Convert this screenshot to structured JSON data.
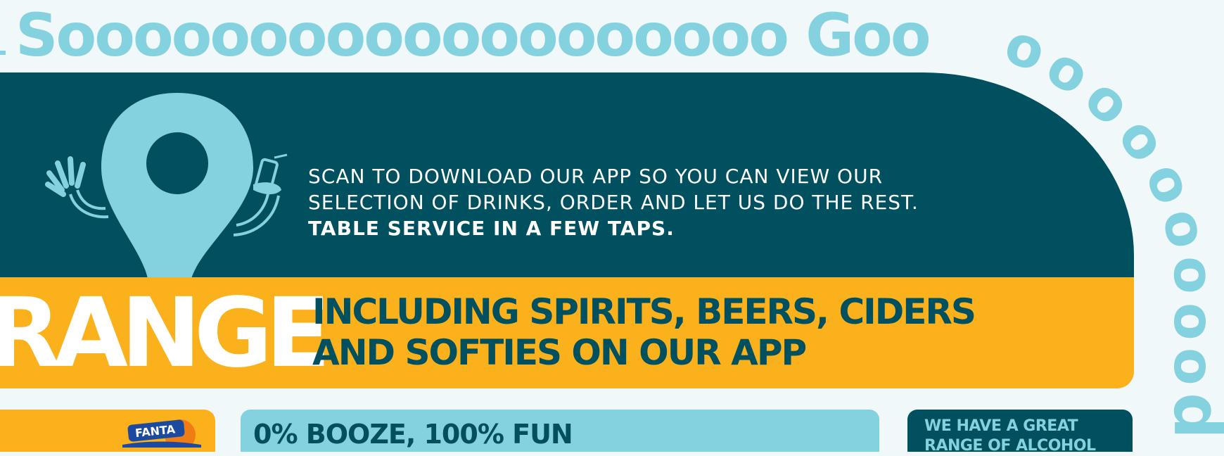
{
  "headline": {
    "text": "Sooooooooooooooooooo Goo",
    "arc_letters": [
      "o",
      "o",
      "o",
      "o",
      "o",
      "o",
      "o",
      "o",
      "o",
      "o",
      "d"
    ]
  },
  "app_promo": {
    "line1": "SCAN TO DOWNLOAD OUR APP SO YOU CAN VIEW OUR",
    "line2": "SELECTION OF DRINKS, ORDER AND LET US DO THE REST.",
    "line3": "TABLE SERVICE IN A FEW TAPS."
  },
  "range_banner": {
    "word": "RANGE",
    "line1": "INCLUDING SPIRITS, BEERS, CIDERS",
    "line2": "AND SOFTIES ON OUR APP"
  },
  "cards": {
    "soft_drink_logo": "FANTA",
    "booze_title": "0% BOOZE, 100% FUN",
    "alcohol_line1": "WE HAVE A GREAT",
    "alcohol_line2": "RANGE OF ALCOHOL"
  },
  "colors": {
    "background": "#f1f8f9",
    "light_blue": "#84d1df",
    "dark_teal": "#00505f",
    "orange": "#fbb11b",
    "white": "#ffffff"
  }
}
